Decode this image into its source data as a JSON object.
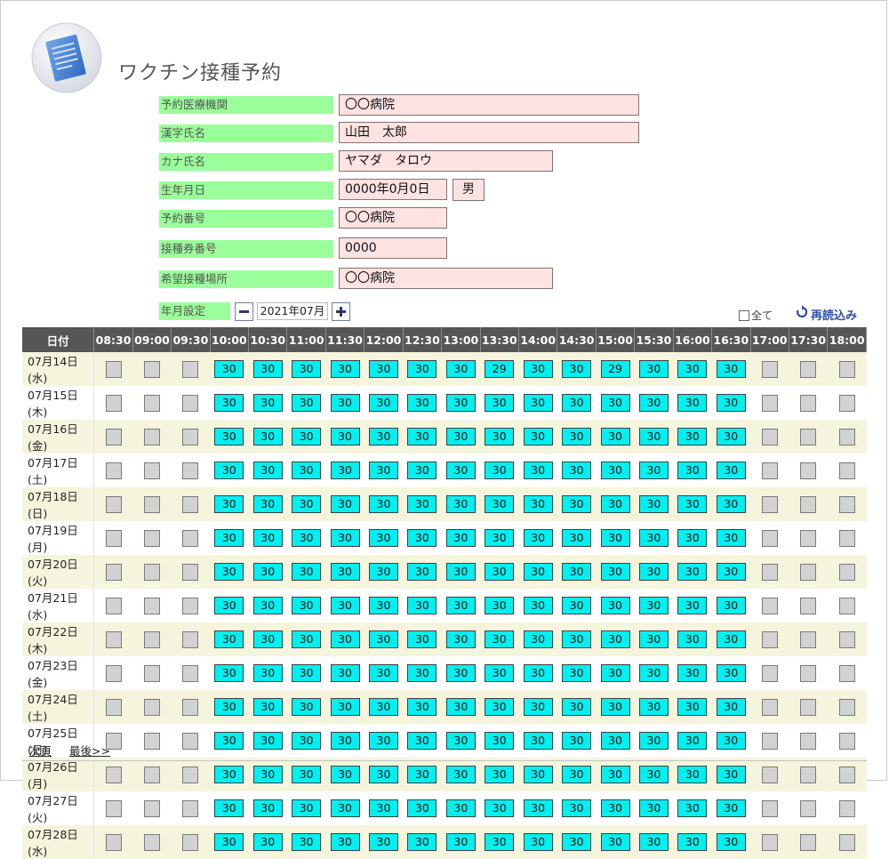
{
  "title": "ワクチン接種予約",
  "icon": "document-icon",
  "form": [
    {
      "key": "institution",
      "label": "予約医療機関",
      "value": "〇〇病院"
    },
    {
      "key": "name_kanji",
      "label": "漢字氏名",
      "value": "山田　太郎"
    },
    {
      "key": "name_kana",
      "label": "カナ氏名",
      "value": "ヤマダ　タロウ"
    },
    {
      "key": "birthdate",
      "label": "生年月日",
      "value": "0000年0月0日"
    },
    {
      "key": "reservation_no",
      "label": "予約番号",
      "value": "〇〇病院"
    },
    {
      "key": "ticket_no",
      "label": "接種券番号",
      "value": "0000"
    },
    {
      "key": "location",
      "label": "希望接種場所",
      "value": "〇〇病院"
    }
  ],
  "gender": "男",
  "month_setting": {
    "label": "年月設定",
    "value": "2021年07月"
  },
  "check_all_label": "全て",
  "reload_label": "再読込み",
  "colors": {
    "label_bg": "#9aff9a",
    "value_bg": "#ffe2e2",
    "slot_available": "#00f0f0",
    "slot_empty": "#d2d2d2",
    "header_bg": "#565656"
  },
  "schedule": {
    "date_header": "日付",
    "times": [
      "08:30",
      "09:00",
      "09:30",
      "10:00",
      "10:30",
      "11:00",
      "11:30",
      "12:00",
      "12:30",
      "13:00",
      "13:30",
      "14:00",
      "14:30",
      "15:00",
      "15:30",
      "16:00",
      "16:30",
      "17:00",
      "17:30",
      "18:00"
    ],
    "rows": [
      {
        "date": "07月14日(水)",
        "slots": [
          null,
          null,
          null,
          30,
          30,
          30,
          30,
          30,
          30,
          30,
          29,
          30,
          30,
          29,
          30,
          30,
          30,
          null,
          null,
          null
        ]
      },
      {
        "date": "07月15日(木)",
        "slots": [
          null,
          null,
          null,
          30,
          30,
          30,
          30,
          30,
          30,
          30,
          30,
          30,
          30,
          30,
          30,
          30,
          30,
          null,
          null,
          null
        ]
      },
      {
        "date": "07月16日(金)",
        "slots": [
          null,
          null,
          null,
          30,
          30,
          30,
          30,
          30,
          30,
          30,
          30,
          30,
          30,
          30,
          30,
          30,
          30,
          null,
          null,
          null
        ]
      },
      {
        "date": "07月17日(土)",
        "slots": [
          null,
          null,
          null,
          30,
          30,
          30,
          30,
          30,
          30,
          30,
          30,
          30,
          30,
          30,
          30,
          30,
          30,
          null,
          null,
          null
        ]
      },
      {
        "date": "07月18日(日)",
        "slots": [
          null,
          null,
          null,
          30,
          30,
          30,
          30,
          30,
          30,
          30,
          30,
          30,
          30,
          30,
          30,
          30,
          30,
          null,
          null,
          null
        ]
      },
      {
        "date": "07月19日(月)",
        "slots": [
          null,
          null,
          null,
          30,
          30,
          30,
          30,
          30,
          30,
          30,
          30,
          30,
          30,
          30,
          30,
          30,
          30,
          null,
          null,
          null
        ]
      },
      {
        "date": "07月20日(火)",
        "slots": [
          null,
          null,
          null,
          30,
          30,
          30,
          30,
          30,
          30,
          30,
          30,
          30,
          30,
          30,
          30,
          30,
          30,
          null,
          null,
          null
        ]
      },
      {
        "date": "07月21日(水)",
        "slots": [
          null,
          null,
          null,
          30,
          30,
          30,
          30,
          30,
          30,
          30,
          30,
          30,
          30,
          30,
          30,
          30,
          30,
          null,
          null,
          null
        ]
      },
      {
        "date": "07月22日(木)",
        "slots": [
          null,
          null,
          null,
          30,
          30,
          30,
          30,
          30,
          30,
          30,
          30,
          30,
          30,
          30,
          30,
          30,
          30,
          null,
          null,
          null
        ]
      },
      {
        "date": "07月23日(金)",
        "slots": [
          null,
          null,
          null,
          30,
          30,
          30,
          30,
          30,
          30,
          30,
          30,
          30,
          30,
          30,
          30,
          30,
          30,
          null,
          null,
          null
        ]
      },
      {
        "date": "07月24日(土)",
        "slots": [
          null,
          null,
          null,
          30,
          30,
          30,
          30,
          30,
          30,
          30,
          30,
          30,
          30,
          30,
          30,
          30,
          30,
          null,
          null,
          null
        ]
      },
      {
        "date": "07月25日(日)",
        "slots": [
          null,
          null,
          null,
          30,
          30,
          30,
          30,
          30,
          30,
          30,
          30,
          30,
          30,
          30,
          30,
          30,
          30,
          null,
          null,
          null
        ]
      },
      {
        "date": "07月26日(月)",
        "slots": [
          null,
          null,
          null,
          30,
          30,
          30,
          30,
          30,
          30,
          30,
          30,
          30,
          30,
          30,
          30,
          30,
          30,
          null,
          null,
          null
        ]
      },
      {
        "date": "07月27日(火)",
        "slots": [
          null,
          null,
          null,
          30,
          30,
          30,
          30,
          30,
          30,
          30,
          30,
          30,
          30,
          30,
          30,
          30,
          30,
          null,
          null,
          null
        ]
      },
      {
        "date": "07月28日(水)",
        "slots": [
          null,
          null,
          null,
          30,
          30,
          30,
          30,
          30,
          30,
          30,
          30,
          30,
          30,
          30,
          30,
          30,
          30,
          null,
          null,
          null
        ]
      }
    ]
  },
  "pager": {
    "next": "次頁",
    "last": "最後>>"
  }
}
